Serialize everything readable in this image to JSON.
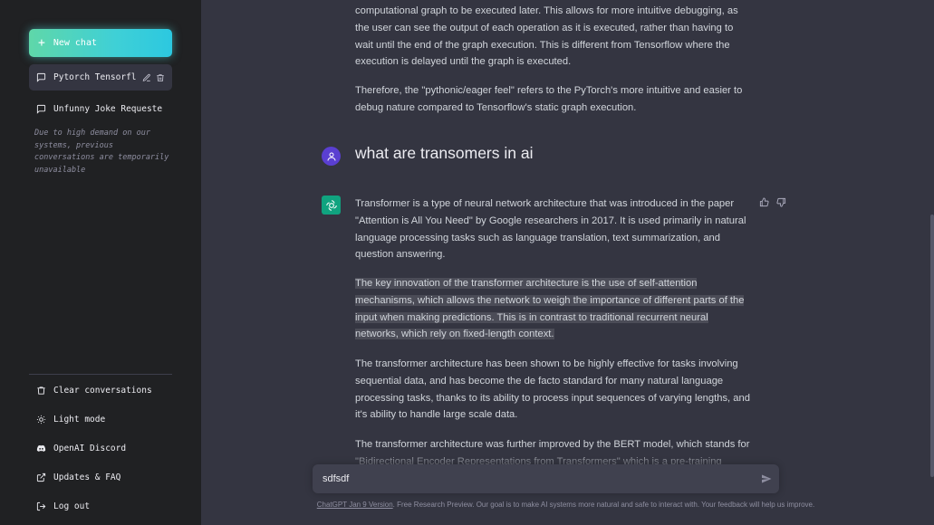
{
  "sidebar": {
    "new_chat_label": "New chat",
    "conversations": [
      {
        "title": "Pytorch Tensorfl"
      },
      {
        "title": "Unfunny Joke Requeste"
      }
    ],
    "notice": "Due to high demand on our systems, previous conversations are temporarily unavailable",
    "bottom": {
      "clear": "Clear conversations",
      "light_mode": "Light mode",
      "discord": "OpenAI Discord",
      "updates": "Updates & FAQ",
      "logout": "Log out"
    }
  },
  "chat": {
    "prev_answer_p1": "computational graph to be executed later. This allows for more intuitive debugging, as the user can see the output of each operation as it is executed, rather than having to wait until the end of the graph execution. This is different from Tensorflow where the execution is delayed until the graph is executed.",
    "prev_answer_p2": "Therefore, the \"pythonic/eager feel\" refers to the PyTorch's more intuitive and easier to debug nature compared to Tensorflow's static graph execution.",
    "user_question": "what are transomers in ai",
    "answer_p1": "Transformer is a type of neural network architecture that was introduced in the paper \"Attention is All You Need\" by Google researchers in 2017. It is used primarily in natural language processing tasks such as language translation, text summarization, and question answering.",
    "answer_p2_a": "The key innovation of the transformer architecture is the use of self-attention mechanisms, which allows the network to weigh the importance of different parts of the input when making predictions. This is in contrast to traditional recurrent neural networks, which rely on fixed-length context.",
    "answer_p3": "The transformer architecture has been shown to be highly effective for tasks involving sequential data, and has become the de facto standard for many natural language processing tasks, thanks to its ability to process input sequences of varying lengths, and it's ability to handle large scale data.",
    "answer_p4": "The transformer architecture was further improved by the BERT model, which stands for \"Bidirectional Encoder Representations from Transformers\" which is a pre-training method"
  },
  "input": {
    "value": "sdfsdf"
  },
  "footer": {
    "link": "ChatGPT Jan 9 Version",
    "text": ". Free Research Preview. Our goal is to make AI systems more natural and safe to interact with. Your feedback will help us improve."
  },
  "colors": {
    "sidebar_bg": "#202123",
    "main_bg": "#343541",
    "accent": "#3fd0d6",
    "bot_avatar": "#10a37f",
    "user_avatar": "#5a3fd1"
  }
}
